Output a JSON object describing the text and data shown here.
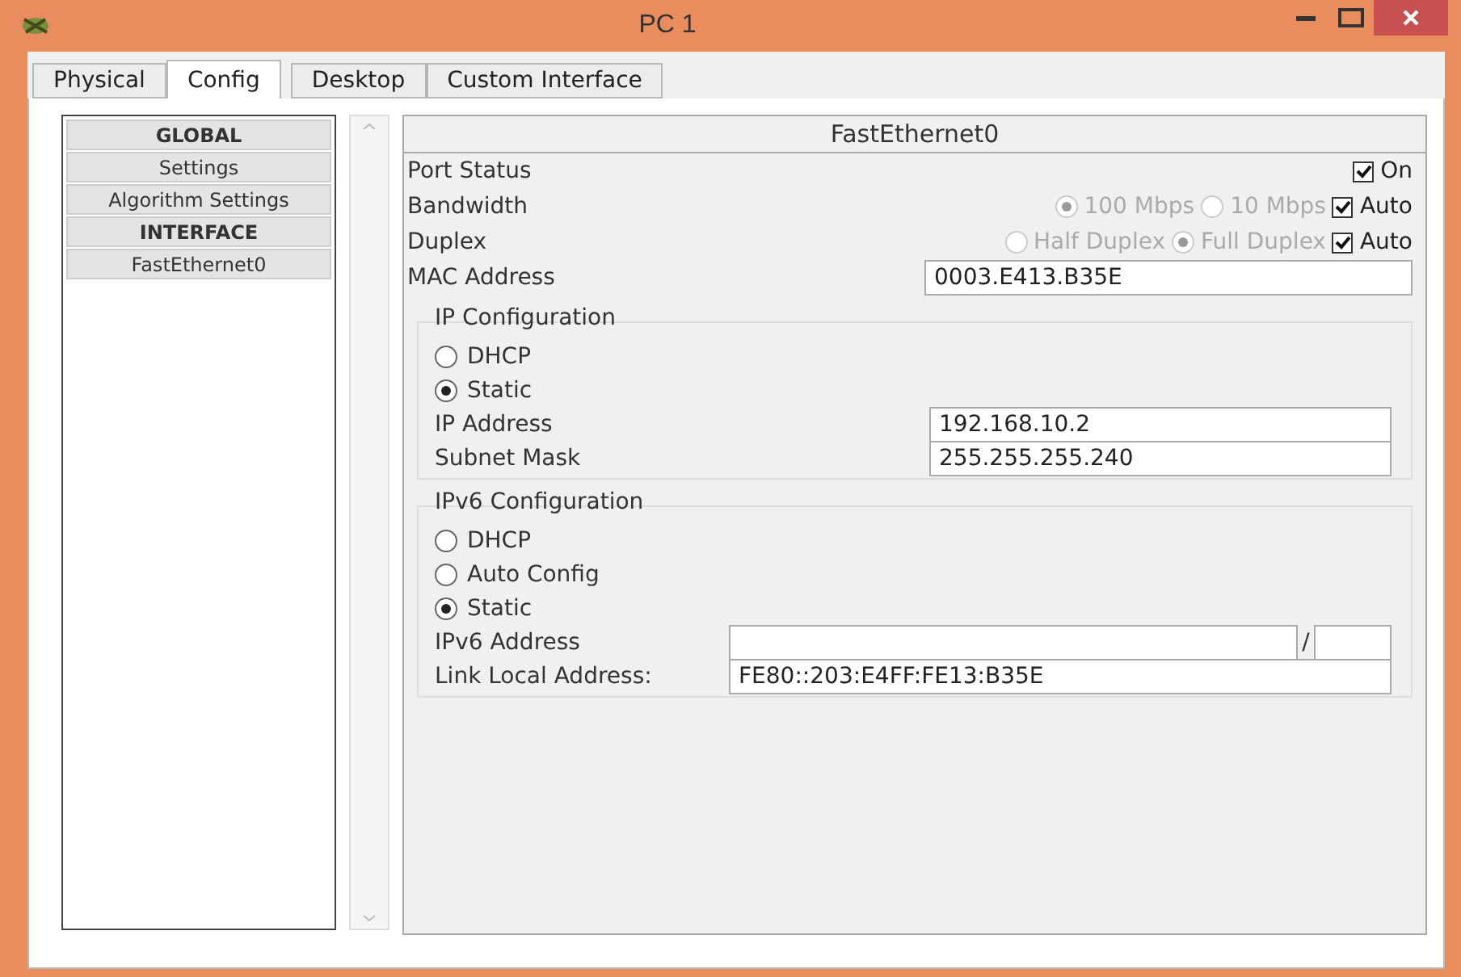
{
  "window": {
    "title": "PC 1"
  },
  "tabs": [
    {
      "label": "Physical",
      "selected": false
    },
    {
      "label": "Config",
      "selected": true
    },
    {
      "label": "Desktop",
      "selected": false
    },
    {
      "label": "Custom Interface",
      "selected": false
    }
  ],
  "sidebar": {
    "items": [
      {
        "label": "GLOBAL",
        "kind": "header"
      },
      {
        "label": "Settings",
        "kind": "item"
      },
      {
        "label": "Algorithm Settings",
        "kind": "item"
      },
      {
        "label": "INTERFACE",
        "kind": "header"
      },
      {
        "label": "FastEthernet0",
        "kind": "item"
      }
    ]
  },
  "panel": {
    "title": "FastEthernet0",
    "port_status": {
      "label": "Port Status",
      "option": {
        "label": "On",
        "checked": true
      }
    },
    "bandwidth": {
      "label": "Bandwidth",
      "disabled": true,
      "options": [
        {
          "label": "100 Mbps",
          "selected": true
        },
        {
          "label": "10 Mbps",
          "selected": false
        }
      ],
      "auto": {
        "label": "Auto",
        "checked": true
      }
    },
    "duplex": {
      "label": "Duplex",
      "disabled": true,
      "options": [
        {
          "label": "Half Duplex",
          "selected": false
        },
        {
          "label": "Full Duplex",
          "selected": true
        }
      ],
      "auto": {
        "label": "Auto",
        "checked": true
      }
    },
    "mac_address": {
      "label": "MAC Address",
      "value": "0003.E413.B35E"
    },
    "ip_configuration": {
      "title": "IP Configuration",
      "modes": [
        {
          "label": "DHCP",
          "selected": false
        },
        {
          "label": "Static",
          "selected": true
        }
      ],
      "fields": [
        {
          "label": "IP Address",
          "value": "192.168.10.2"
        },
        {
          "label": "Subnet Mask",
          "value": "255.255.255.240"
        }
      ]
    },
    "ipv6_configuration": {
      "title": "IPv6 Configuration",
      "modes": [
        {
          "label": "DHCP",
          "selected": false
        },
        {
          "label": "Auto Config",
          "selected": false
        },
        {
          "label": "Static",
          "selected": true
        }
      ],
      "address": {
        "label": "IPv6 Address",
        "separator": "/"
      },
      "link_local": {
        "label": "Link Local Address:",
        "value": "FE80::203:E4FF:FE13:B35E"
      }
    }
  }
}
